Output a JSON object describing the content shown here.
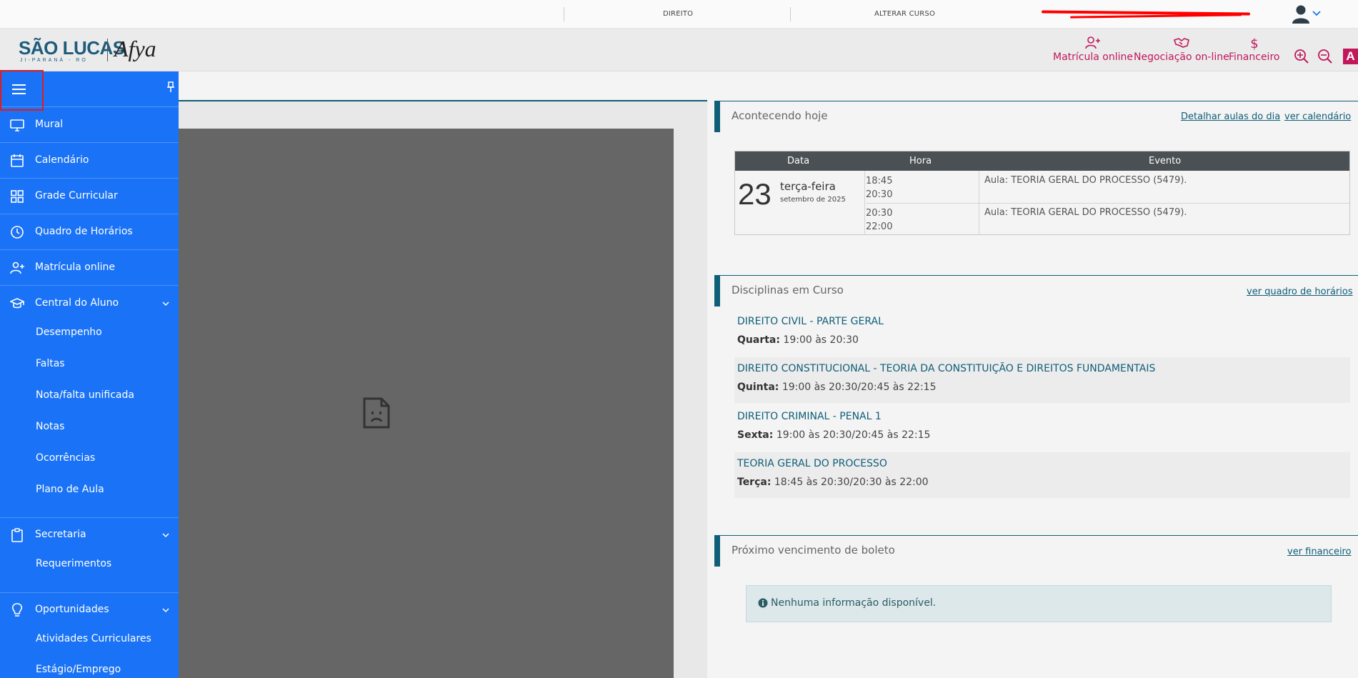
{
  "topbar": {
    "course": "DIREITO",
    "change_course": "ALTERAR CURSO"
  },
  "header": {
    "logo_text": "SÃO LUCAS",
    "logo_sub": "JI-PARANÁ - RO",
    "logo_brand": "Afya",
    "nav": [
      {
        "label": "Matrícula online",
        "icon": "add-user-icon"
      },
      {
        "label": "Negociação on-line",
        "icon": "handshake-icon"
      },
      {
        "label": "Financeiro",
        "icon": "dollar-icon"
      }
    ],
    "font_size_label": "A"
  },
  "sidebar": {
    "items": [
      {
        "label": "Mural",
        "icon": "monitor-icon"
      },
      {
        "label": "Calendário",
        "icon": "calendar-icon"
      },
      {
        "label": "Grade Curricular",
        "icon": "grid-icon"
      },
      {
        "label": "Quadro de Horários",
        "icon": "clock-icon"
      },
      {
        "label": "Matrícula online",
        "icon": "add-user-icon"
      },
      {
        "label": "Central do Aluno",
        "icon": "graduation-cap-icon"
      }
    ],
    "central_sub": [
      "Desempenho",
      "Faltas",
      "Nota/falta unificada",
      "Notas",
      "Ocorrências",
      "Plano de Aula"
    ],
    "secretaria": {
      "label": "Secretaria",
      "icon": "clipboard-icon"
    },
    "secretaria_sub": [
      "Requerimentos"
    ],
    "oportunidades": {
      "label": "Oportunidades",
      "icon": "lightbulb-icon"
    },
    "oportunidades_sub": [
      "Atividades Curriculares",
      "Estágio/Emprego"
    ]
  },
  "today": {
    "title": "Acontecendo hoje",
    "link_detail": "Detalhar aulas do dia",
    "link_calendar": "ver calendário",
    "columns": [
      "Data",
      "Hora",
      "Evento"
    ],
    "day": "23",
    "weekday": "terça-feira",
    "month_year": "setembro de 2025",
    "rows": [
      {
        "start": "18:45",
        "end": "20:30",
        "event": "Aula: TEORIA GERAL DO PROCESSO (5479)."
      },
      {
        "start": "20:30",
        "end": "22:00",
        "event": "Aula: TEORIA GERAL DO PROCESSO (5479)."
      }
    ]
  },
  "courses": {
    "title": "Disciplinas em Curso",
    "link": "ver quadro de horários",
    "items": [
      {
        "name": "DIREITO CIVIL - PARTE GERAL",
        "day": "Quarta:",
        "time": "19:00 às 20:30"
      },
      {
        "name": "DIREITO CONSTITUCIONAL - TEORIA DA CONSTITUIÇÃO E DIREITOS FUNDAMENTAIS",
        "day": "Quinta:",
        "time": "19:00 às 20:30/20:45 às 22:15"
      },
      {
        "name": "DIREITO CRIMINAL - PENAL 1",
        "day": "Sexta:",
        "time": "19:00 às 20:30/20:45 às 22:15"
      },
      {
        "name": "TEORIA GERAL DO PROCESSO",
        "day": "Terça:",
        "time": "18:45 às 20:30/20:30 às 22:00"
      }
    ]
  },
  "billing": {
    "title": "Próximo vencimento de boleto",
    "link": "ver financeiro",
    "info": "Nenhuma informação disponível."
  },
  "colors": {
    "sidebar": "#1a73f7",
    "accent": "#c0185a",
    "teal": "#0e5e78"
  }
}
